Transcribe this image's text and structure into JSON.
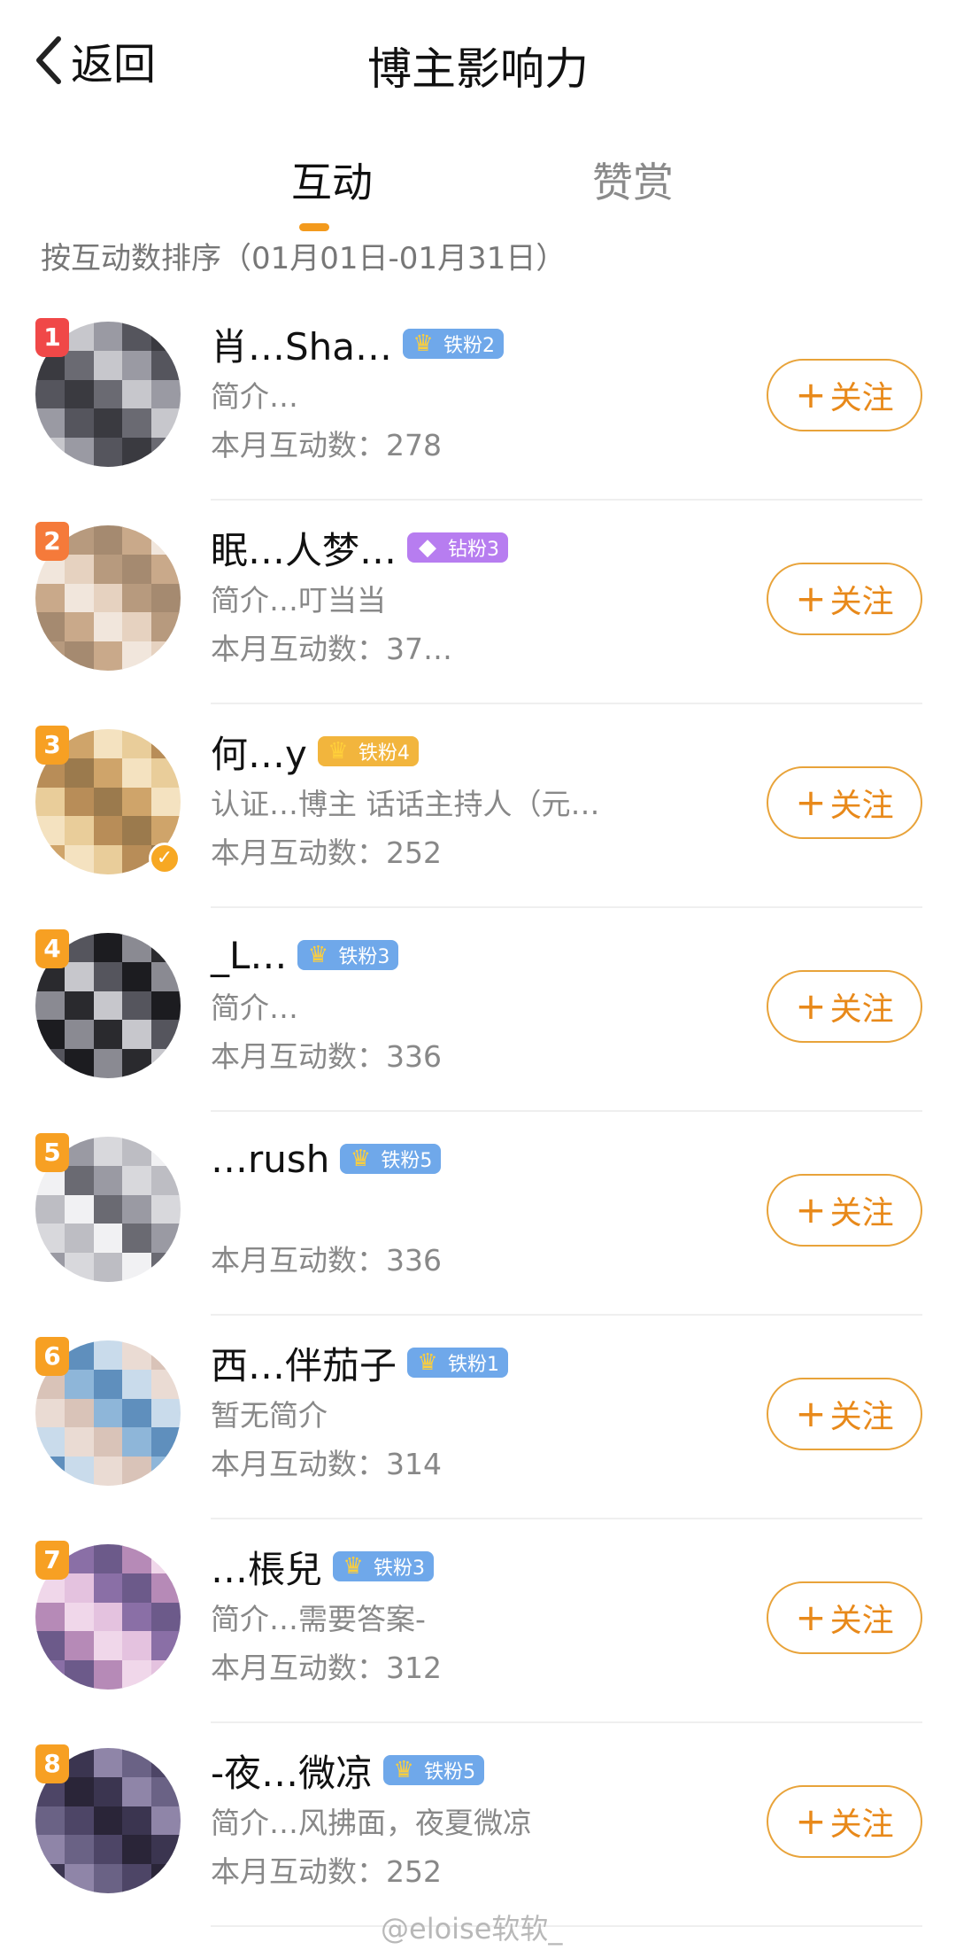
{
  "header": {
    "back_label": "返回",
    "title": "博主影响力"
  },
  "tabs": [
    {
      "label": "互动",
      "active": true
    },
    {
      "label": "赞赏",
      "active": false
    }
  ],
  "sort_hint": "按互动数排序（01月01日-01月31日）",
  "follow_label": "关注",
  "rows": [
    {
      "rank": "1",
      "rank_color": "#f04848",
      "name": "肖…Sha…",
      "fan_badge": "铁粉2",
      "fan_type": "iron",
      "bio": "简介…",
      "count": "本月互动数：278"
    },
    {
      "rank": "2",
      "rank_color": "#f57a3a",
      "name": "眠…人梦…",
      "fan_badge": "钻粉3",
      "fan_type": "diamond",
      "bio": "简介…叮当当",
      "count": "本月互动数：37…"
    },
    {
      "rank": "3",
      "rank_color": "#f7a023",
      "name": "何…y",
      "fan_badge": "铁粉4",
      "fan_type": "gold",
      "bio": "认证…博主 话话主持人（元…",
      "count": "本月互动数：252",
      "verified": true
    },
    {
      "rank": "4",
      "rank_color": "#f7a023",
      "name": "_L…",
      "fan_badge": "铁粉3",
      "fan_type": "iron",
      "bio": "简介…",
      "count": "本月互动数：336"
    },
    {
      "rank": "5",
      "rank_color": "#f7a023",
      "name": "…rush",
      "fan_badge": "铁粉5",
      "fan_type": "iron",
      "bio": "",
      "count": "本月互动数：336"
    },
    {
      "rank": "6",
      "rank_color": "#f7a023",
      "name": "西…伴茄子",
      "fan_badge": "铁粉1",
      "fan_type": "iron",
      "bio": "暂无简介",
      "count": "本月互动数：314"
    },
    {
      "rank": "7",
      "rank_color": "#f7a023",
      "name": "…棖兒",
      "fan_badge": "铁粉3",
      "fan_type": "iron",
      "bio": "简介…需要答案-",
      "count": "本月互动数：312"
    },
    {
      "rank": "8",
      "rank_color": "#f7a023",
      "name": "-夜…微凉",
      "fan_badge": "铁粉5",
      "fan_type": "iron",
      "bio": "简介…风拂面，夜夏微凉",
      "count": "本月互动数：252"
    }
  ],
  "watermark": "@eloise软软_",
  "colors": {
    "accent": "#e8891a",
    "tab_indicator": "#f39a1d",
    "iron_fan": "#6fa8ea",
    "diamond_fan": "#b77df0"
  }
}
